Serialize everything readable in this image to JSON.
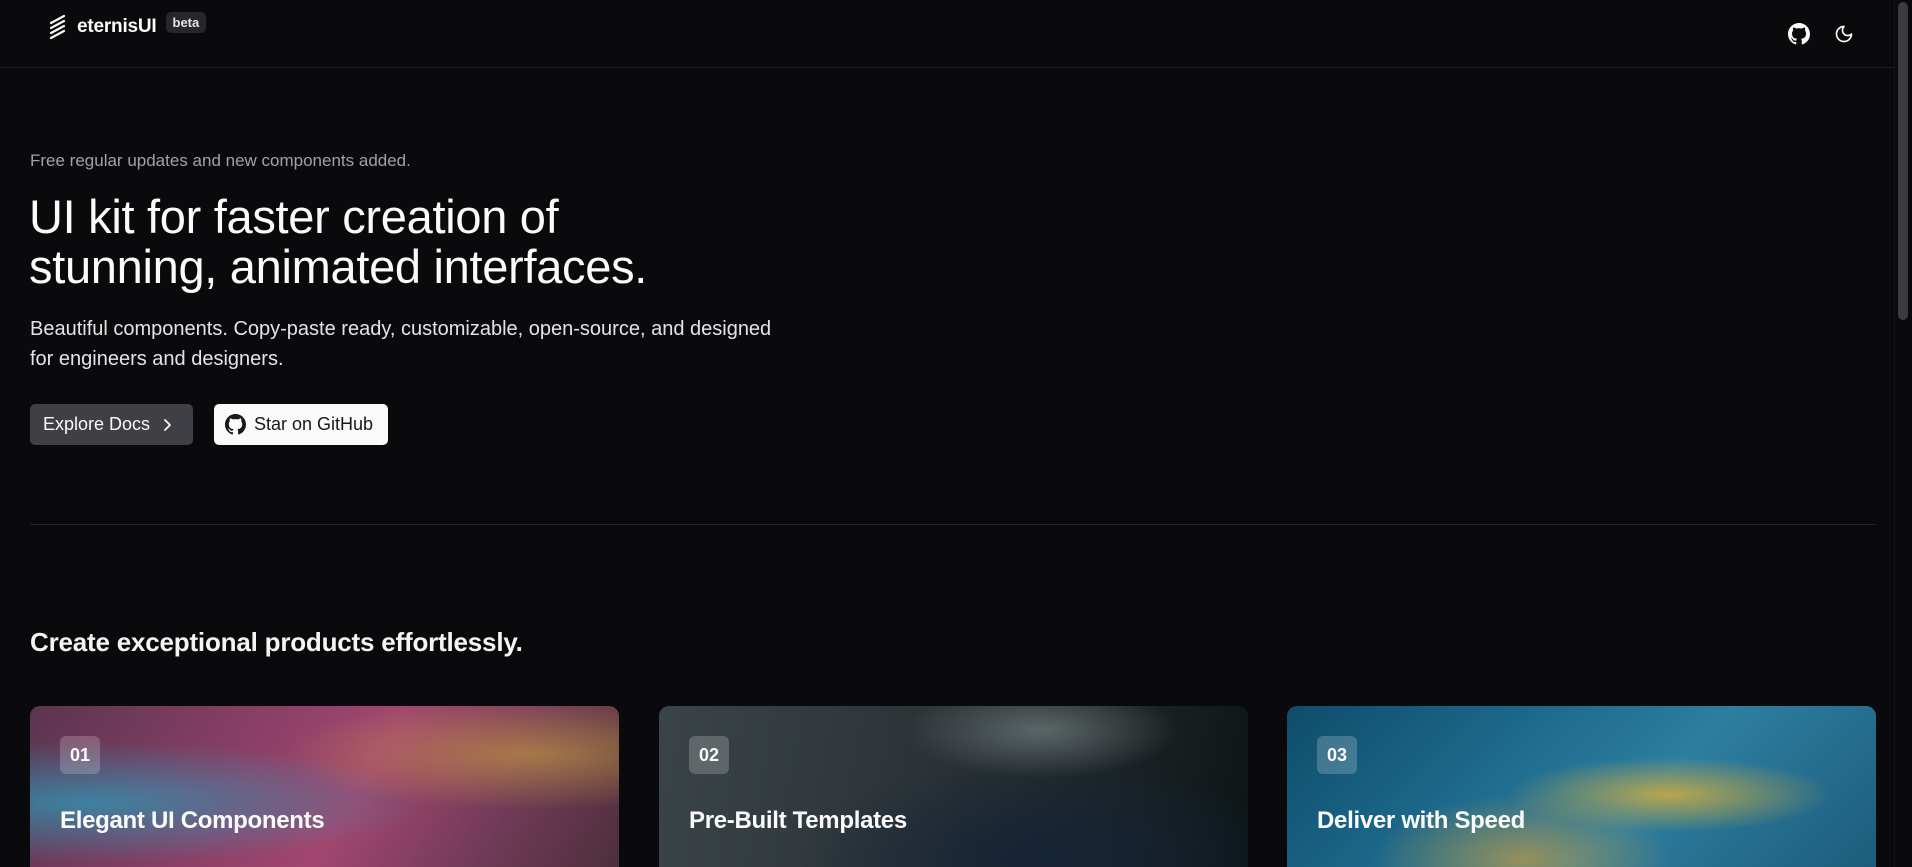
{
  "header": {
    "brand_name": "eternisUI",
    "badge": "beta",
    "logo_icon": "stacked-lines-logo-icon",
    "github_icon": "github-icon",
    "theme_icon": "moon-icon"
  },
  "hero": {
    "eyebrow": "Free regular updates and new components added.",
    "title_line1": "UI kit for faster creation of",
    "title_line2": "stunning, animated interfaces.",
    "description": "Beautiful components. Copy-paste ready, customizable, open-source, and designed for engineers and designers.",
    "primary_button": "Explore Docs",
    "primary_button_icon": "chevron-right-icon",
    "secondary_button": "Star on GitHub",
    "secondary_button_icon": "github-icon"
  },
  "features": {
    "title": "Create exceptional products effortlessly.",
    "cards": [
      {
        "number": "01",
        "title": "Elegant UI Components"
      },
      {
        "number": "02",
        "title": "Pre-Built Templates"
      },
      {
        "number": "03",
        "title": "Deliver with Speed"
      }
    ]
  },
  "colors": {
    "background": "#0a0a0c",
    "primary_button": "#3f3f46",
    "secondary_button": "#fafafa",
    "muted_text": "#a1a1aa"
  }
}
